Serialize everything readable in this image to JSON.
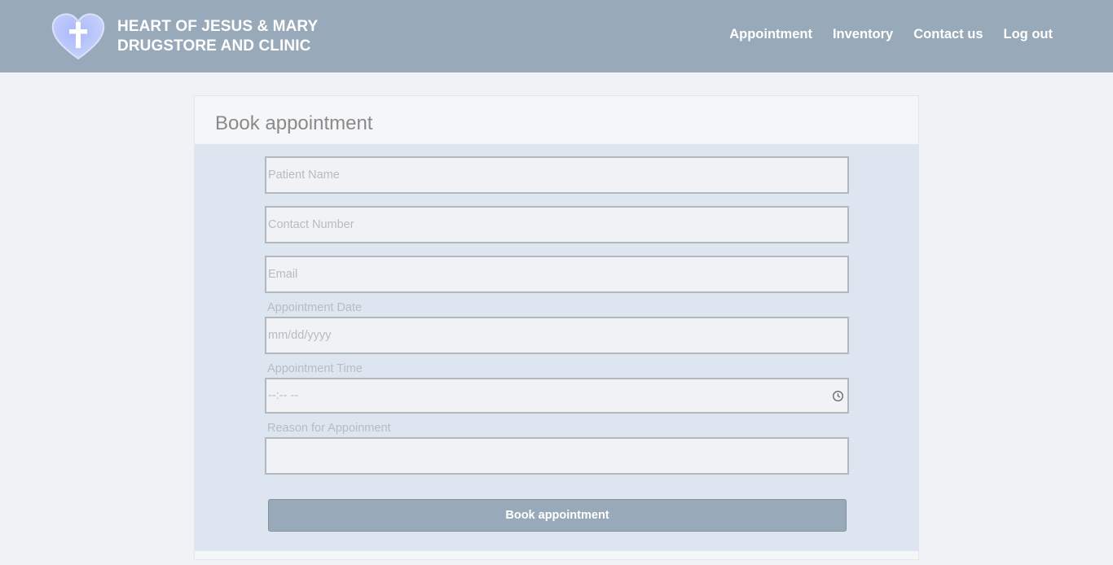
{
  "brand": {
    "line1": "HEART OF JESUS & MARY",
    "line2": "DRUGSTORE AND CLINIC",
    "logo_icon": "heart-cross-icon"
  },
  "nav": {
    "items": [
      "Appointment",
      "Inventory",
      "Contact us",
      "Log out"
    ]
  },
  "form": {
    "title": "Book appointment",
    "patient_name_placeholder": "Patient Name",
    "contact_number_placeholder": "Contact Number",
    "email_placeholder": "Email",
    "date_label": "Appointment Date",
    "date_placeholder": "mm/dd/yyyy",
    "time_label": "Appointment Time",
    "time_value": "--:-- --",
    "reason_label": "Reason for Appoinment",
    "submit_label": "Book appointment"
  },
  "colors": {
    "navbar": "#98a9b9",
    "form_body": "#dde6f0",
    "page_bg": "#f0f2f5",
    "logo_heart": "#b4c4fb"
  }
}
